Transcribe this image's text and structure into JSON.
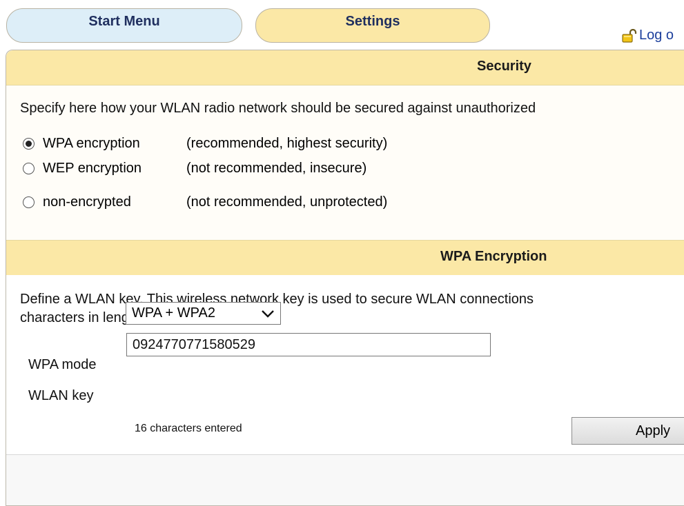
{
  "tabs": {
    "start_menu": "Start Menu",
    "settings": "Settings"
  },
  "logout": {
    "label": "Log o",
    "icon": "open-lock-icon"
  },
  "security": {
    "title": "Security",
    "intro": "Specify here how your WLAN radio network should be secured against unauthorized",
    "options": [
      {
        "label": "WPA encryption",
        "desc": "(recommended, highest security)",
        "checked": true
      },
      {
        "label": "WEP encryption",
        "desc": "(not recommended, insecure)",
        "checked": false
      },
      {
        "label": "non-encrypted",
        "desc": "(not recommended, unprotected)",
        "checked": false
      }
    ]
  },
  "wpa": {
    "title": "WPA Encryption",
    "description_line1": "Define a WLAN key. This wireless network key is used to secure WLAN connections",
    "description_line2": "characters in length.",
    "mode_label": "WPA mode",
    "mode_value": "WPA + WPA2",
    "key_label": "WLAN key",
    "key_value": "0924770771580529",
    "char_count": "16 characters entered"
  },
  "apply_label": "Apply",
  "colors": {
    "header_bg": "#fbe8a6",
    "start_tab_bg": "#ddeef8",
    "link_blue": "#1c3f9c"
  }
}
